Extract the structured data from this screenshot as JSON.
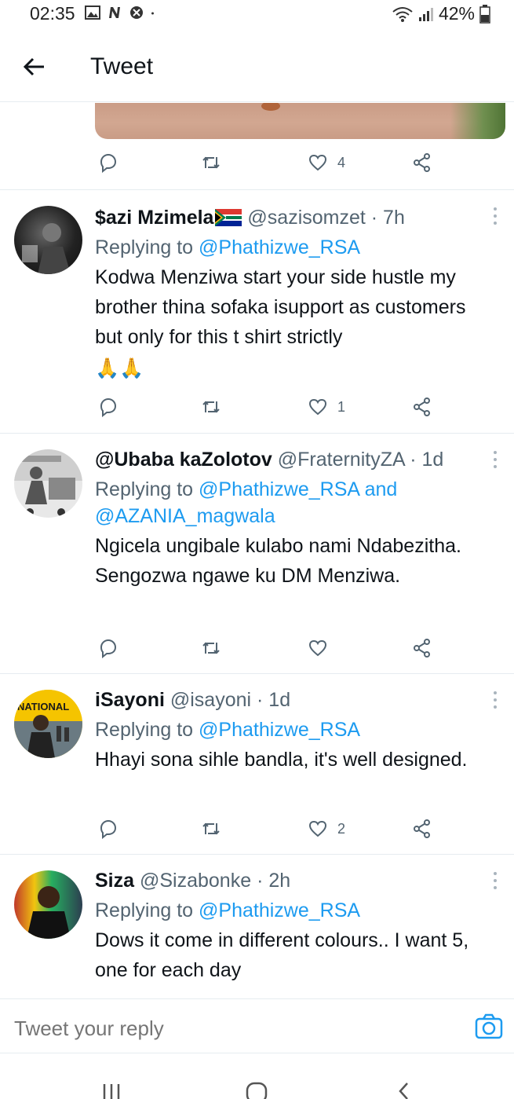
{
  "status_bar": {
    "time": "02:35",
    "battery": "42%",
    "left_icons": [
      "image-icon",
      "n-icon",
      "shield-icon",
      "dot-icon"
    ],
    "right_icons": [
      "wifi-icon",
      "signal-icon",
      "battery-icon"
    ]
  },
  "header": {
    "title": "Tweet"
  },
  "top_tweet_actions": {
    "like_count": "4"
  },
  "replies": [
    {
      "name": "$azi Mzimela",
      "handle": "@sazisomzet",
      "time": "· 7h",
      "replying_prefix": "Replying to ",
      "mentions": "@Phathizwe_RSA",
      "text": "Kodwa Menziwa start your side hustle my brother thina sofaka isupport as customers but only for this t shirt strictly",
      "emoji": "🙏🙏",
      "like_count": "1"
    },
    {
      "name": "@Ubaba kaZolotov",
      "handle": "@FraternityZA",
      "time": "· 1d",
      "replying_prefix": "Replying to ",
      "mentions": "@Phathizwe_RSA and @AZANIA_magwala",
      "text": "Ngicela ungibale kulabo nami Ndabezitha. Sengozwa ngawe ku DM Menziwa.",
      "like_count": ""
    },
    {
      "name": "iSayoni",
      "handle": "@isayoni",
      "time": "· 1d",
      "replying_prefix": "Replying to ",
      "mentions": "@Phathizwe_RSA",
      "text": "Hhayi sona sihle bandla, it's well designed.",
      "like_count": "2"
    },
    {
      "name": "Siza",
      "handle": "@Sizabonke",
      "time": "· 2h",
      "replying_prefix": "Replying to ",
      "mentions": "@Phathizwe_RSA",
      "text": "Dows it come in different colours.. I want 5, one for each day"
    }
  ],
  "reply_bar": {
    "placeholder": "Tweet your reply"
  },
  "colors": {
    "link": "#1d9bf0",
    "secondary_text": "#536471",
    "divider": "#e6ecf0"
  }
}
